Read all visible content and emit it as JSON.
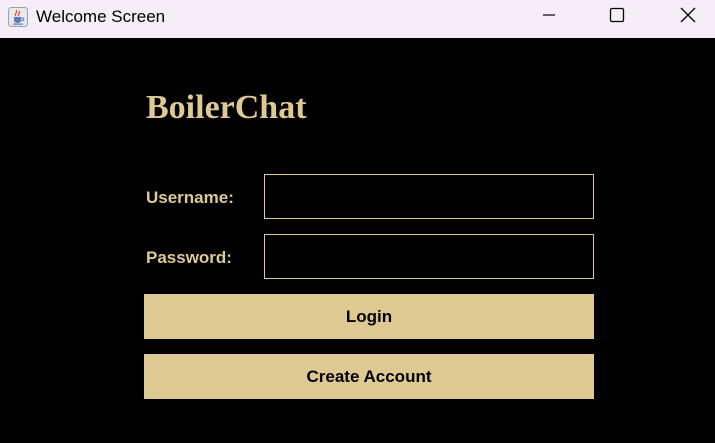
{
  "window": {
    "title": "Welcome Screen",
    "icon": "java-cup-icon",
    "controls": [
      "minimize-icon",
      "maximize-icon",
      "close-icon"
    ]
  },
  "app": {
    "title": "BoilerChat"
  },
  "form": {
    "username_label": "Username:",
    "username_value": "",
    "password_label": "Password:",
    "password_value": ""
  },
  "buttons": {
    "login_label": "Login",
    "create_account_label": "Create Account"
  },
  "colors": {
    "accent": "#dfc992",
    "background": "#000000",
    "titlebar": "#f6edf8"
  }
}
